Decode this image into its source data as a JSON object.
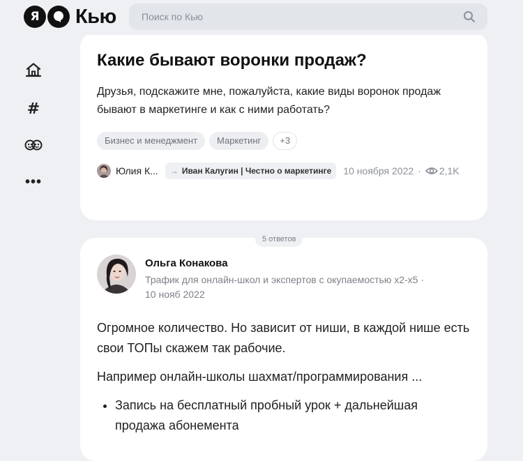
{
  "header": {
    "logo_ya": "Я",
    "logo_text": "Кью",
    "search_placeholder": "Поиск по Кью"
  },
  "nav": {
    "items": [
      {
        "name": "home",
        "icon": "home-icon"
      },
      {
        "name": "topics",
        "icon": "hashtag-icon",
        "glyph": "#"
      },
      {
        "name": "experts",
        "icon": "faces-icon"
      },
      {
        "name": "more",
        "icon": "more-dots-icon",
        "glyph": "•••"
      }
    ]
  },
  "question": {
    "title": "Какие бывают воронки продаж?",
    "body": "Друзья, подскажите мне, пожалуйста, какие виды воронок продаж бывают в маркетинге и как с ними работать?",
    "tags": [
      "Бизнес и менеджмент",
      "Маркетинг"
    ],
    "tags_more": "+3",
    "author": "Юлия К...",
    "forwarded_to": "Иван Калугин | Честно о маркетинге",
    "date": "10 ноября 2022",
    "separator": "·",
    "views": "2,1K"
  },
  "answers": {
    "count_label": "5 ответов",
    "first": {
      "author_name": "Ольга Конакова",
      "author_description": "Трафик для онлайн-школ и экспертов с окупаемостью х2-х5 ·",
      "date": "10 нояб 2022",
      "paragraphs": [
        "Огромное количество. Но зависит от ниши, в каждой нише есть свои ТОПы скажем так рабочие.",
        "Например онлайн-школы шахмат/программирования ..."
      ],
      "list": [
        "Запись на бесплатный пробный урок + дальнейшая продажа абонемента"
      ]
    }
  },
  "colors": {
    "page_background": "#eef0f3",
    "card_background": "#ffffff",
    "muted_text": "#8b8f96",
    "tag_background": "#eceef1"
  }
}
